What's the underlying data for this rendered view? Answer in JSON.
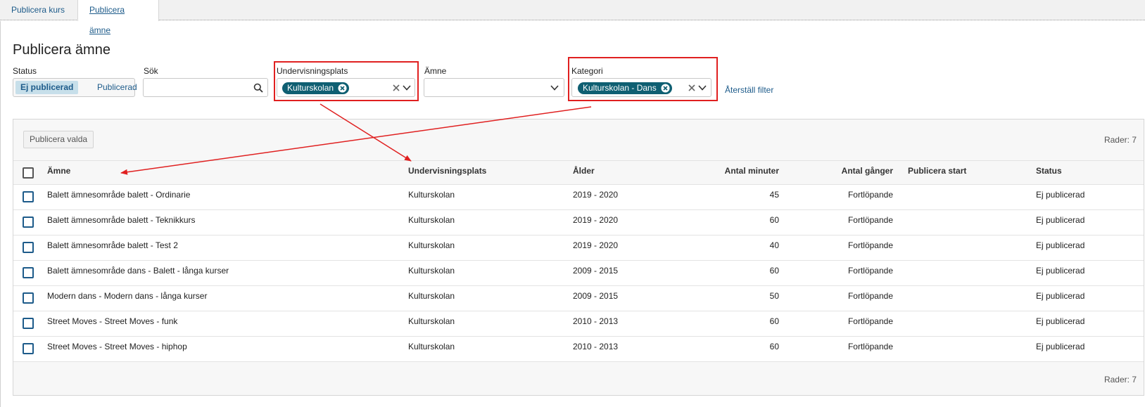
{
  "tabs": [
    {
      "label": "Publicera kurs"
    },
    {
      "label": "Publicera ämne"
    }
  ],
  "page_title": "Publicera ämne",
  "filters": {
    "status": {
      "label": "Status",
      "options": [
        "Ej publicerad",
        "Publicerad"
      ],
      "selected": "Ej publicerad"
    },
    "search": {
      "label": "Sök",
      "value": ""
    },
    "undervisningsplats": {
      "label": "Undervisningsplats",
      "chips": [
        "Kulturskolan"
      ]
    },
    "amne": {
      "label": "Ämne",
      "value": ""
    },
    "kategori": {
      "label": "Kategori",
      "chips": [
        "Kulturskolan - Dans"
      ]
    },
    "reset_label": "Återställ filter"
  },
  "table": {
    "publish_selected_label": "Publicera valda",
    "rows_count_top": "Rader: 7",
    "rows_count_bottom": "Rader: 7",
    "headers": {
      "amne": "Ämne",
      "plats": "Undervisningsplats",
      "alder": "Ålder",
      "minuter": "Antal minuter",
      "ganger": "Antal gånger",
      "start": "Publicera start",
      "status": "Status"
    },
    "rows": [
      {
        "amne": "Balett ämnesområde balett - Ordinarie",
        "plats": "Kulturskolan",
        "alder": "2019 - 2020",
        "minuter": "45",
        "ganger": "Fortlöpande",
        "start": "",
        "status": "Ej publicerad"
      },
      {
        "amne": "Balett ämnesområde balett - Teknikkurs",
        "plats": "Kulturskolan",
        "alder": "2019 - 2020",
        "minuter": "60",
        "ganger": "Fortlöpande",
        "start": "",
        "status": "Ej publicerad"
      },
      {
        "amne": "Balett ämnesområde balett - Test 2",
        "plats": "Kulturskolan",
        "alder": "2019 - 2020",
        "minuter": "40",
        "ganger": "Fortlöpande",
        "start": "",
        "status": "Ej publicerad"
      },
      {
        "amne": "Balett ämnesområde dans - Balett - långa kurser",
        "plats": "Kulturskolan",
        "alder": "2009 - 2015",
        "minuter": "60",
        "ganger": "Fortlöpande",
        "start": "",
        "status": "Ej publicerad"
      },
      {
        "amne": "Modern dans - Modern dans - långa kurser",
        "plats": "Kulturskolan",
        "alder": "2009 - 2015",
        "minuter": "50",
        "ganger": "Fortlöpande",
        "start": "",
        "status": "Ej publicerad"
      },
      {
        "amne": "Street Moves - Street Moves - funk",
        "plats": "Kulturskolan",
        "alder": "2010 - 2013",
        "minuter": "60",
        "ganger": "Fortlöpande",
        "start": "",
        "status": "Ej publicerad"
      },
      {
        "amne": "Street Moves - Street Moves - hiphop",
        "plats": "Kulturskolan",
        "alder": "2010 - 2013",
        "minuter": "60",
        "ganger": "Fortlöpande",
        "start": "",
        "status": "Ej publicerad"
      }
    ]
  },
  "colors": {
    "accent": "#1d5b8a",
    "chip": "#0f5f72",
    "annotation": "#e02020"
  }
}
